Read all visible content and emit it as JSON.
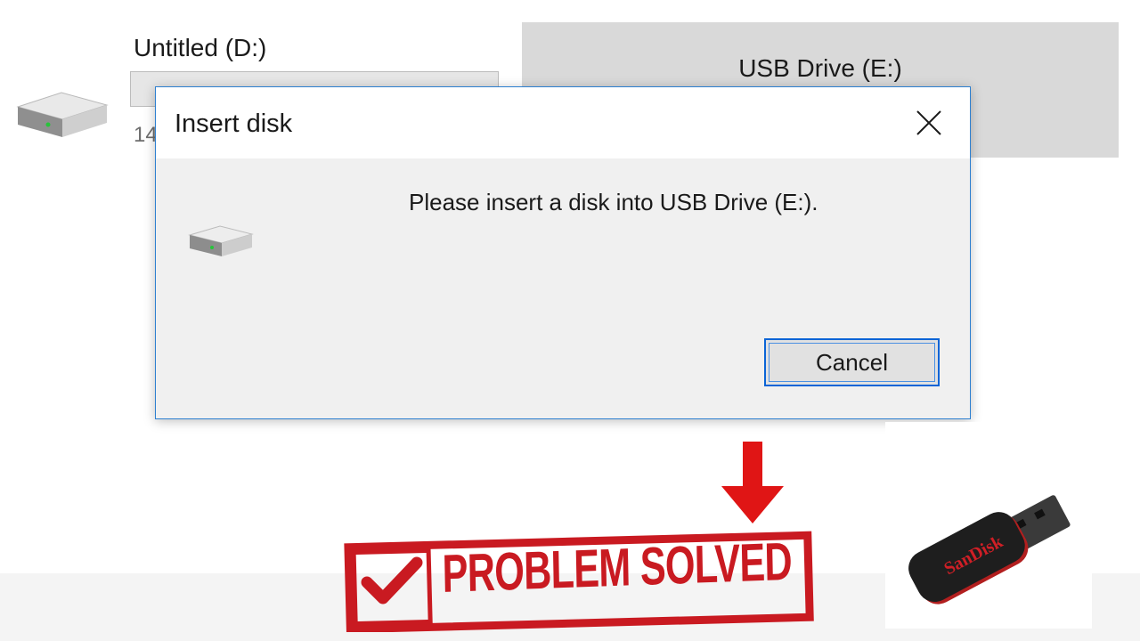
{
  "explorer": {
    "drive_d": {
      "label": "Untitled (D:)",
      "size_text": "14",
      "icon": "hard-drive-icon"
    },
    "drive_e": {
      "label": "USB Drive (E:)"
    }
  },
  "dialog": {
    "title": "Insert disk",
    "message": "Please insert a disk into USB Drive (E:).",
    "icon": "drive-icon",
    "close_icon": "close-icon",
    "cancel_label": "Cancel"
  },
  "overlay": {
    "stamp_text": "PROBLEM SOLVED",
    "stamp_icon": "checkmark-icon",
    "arrow_icon": "down-arrow-icon",
    "usb_brand": "SanDisk"
  },
  "colors": {
    "dialog_border": "#2c7fd0",
    "button_focus": "#0a64d6",
    "stamp_red": "#c91a21",
    "tile_gray": "#d9d9d9"
  }
}
